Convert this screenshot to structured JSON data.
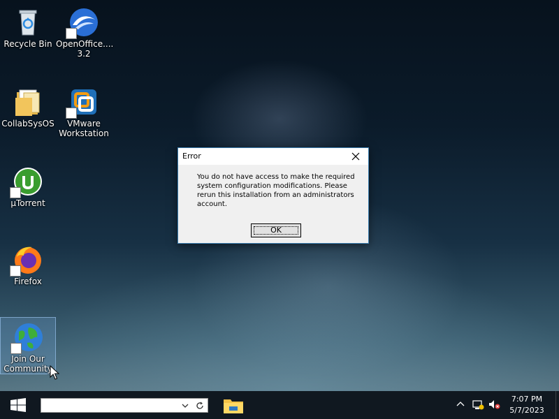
{
  "desktop": {
    "icons": [
      {
        "label": "Recycle Bin",
        "icon": "recycle-bin-icon"
      },
      {
        "label": "OpenOffice....\n3.2",
        "icon": "openoffice-icon"
      },
      {
        "label": "CollabSysOS",
        "icon": "folder-icon"
      },
      {
        "label": "VMware\nWorkstation",
        "icon": "vmware-icon"
      },
      {
        "label": "µTorrent",
        "icon": "utorrent-icon"
      },
      {
        "label": "Firefox",
        "icon": "firefox-icon"
      },
      {
        "label": "Join Our\nCommunity",
        "icon": "globe-icon"
      }
    ]
  },
  "dialog": {
    "title": "Error",
    "message": "You do not have access to make the required system configuration modifications. Please rerun this installation from an administrators account.",
    "ok_label": "OK"
  },
  "taskbar": {
    "search": {
      "value": "",
      "placeholder": ""
    },
    "clock": {
      "time": "7:07 PM",
      "date": "5/7/2023"
    }
  },
  "colors": {
    "taskbar_bg": "#101820",
    "dialog_border": "#3c7fb1",
    "dialog_bg": "#f0f0f0"
  }
}
